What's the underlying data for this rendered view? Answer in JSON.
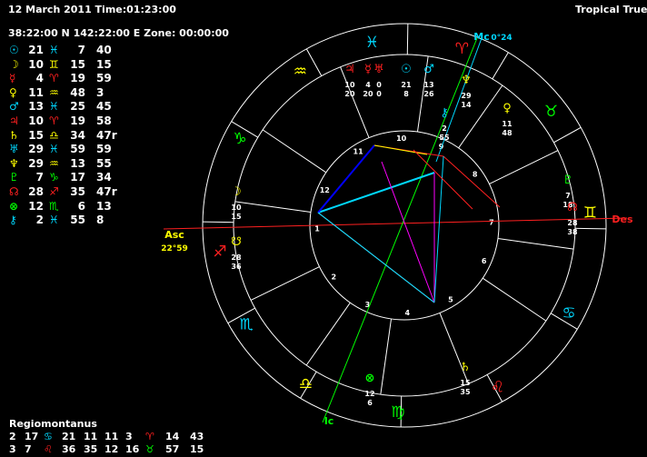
{
  "header": {
    "date_time": "12 March 2011 Time:01:23:00",
    "zodiac": "Tropical True",
    "location": "38:22:00 N 142:22:00 E Zone: 00:00:00"
  },
  "planets": [
    {
      "name": "sun",
      "glyph": "☉",
      "color": "#00d8ff",
      "deg": "21",
      "sign_glyph": "♓",
      "sign_color": "#00d8ff",
      "min": "7",
      "sec": "40"
    },
    {
      "name": "moon",
      "glyph": "☽",
      "color": "#ffff00",
      "deg": "10",
      "sign_glyph": "♊",
      "sign_color": "#ffff00",
      "min": "15",
      "sec": "15"
    },
    {
      "name": "mercury",
      "glyph": "☿",
      "color": "#ff2020",
      "deg": "4",
      "sign_glyph": "♈",
      "sign_color": "#ff2020",
      "min": "19",
      "sec": "59"
    },
    {
      "name": "venus",
      "glyph": "♀",
      "color": "#ffff00",
      "deg": "11",
      "sign_glyph": "♒",
      "sign_color": "#ffff00",
      "min": "48",
      "sec": "3"
    },
    {
      "name": "mars",
      "glyph": "♂",
      "color": "#00d8ff",
      "deg": "13",
      "sign_glyph": "♓",
      "sign_color": "#00d8ff",
      "min": "25",
      "sec": "45"
    },
    {
      "name": "jupiter",
      "glyph": "♃",
      "color": "#ff2020",
      "deg": "10",
      "sign_glyph": "♈",
      "sign_color": "#ff2020",
      "min": "19",
      "sec": "58"
    },
    {
      "name": "saturn",
      "glyph": "♄",
      "color": "#ffff00",
      "deg": "15",
      "sign_glyph": "♎",
      "sign_color": "#ffff00",
      "min": "34",
      "sec": "47r"
    },
    {
      "name": "uranus",
      "glyph": "♅",
      "color": "#00d8ff",
      "deg": "29",
      "sign_glyph": "♓",
      "sign_color": "#00d8ff",
      "min": "59",
      "sec": "59"
    },
    {
      "name": "neptune",
      "glyph": "♆",
      "color": "#ffff00",
      "deg": "29",
      "sign_glyph": "♒",
      "sign_color": "#ffff00",
      "min": "13",
      "sec": "55"
    },
    {
      "name": "pluto",
      "glyph": "♇",
      "color": "#00ff00",
      "deg": "7",
      "sign_glyph": "♑",
      "sign_color": "#00ff00",
      "min": "17",
      "sec": "34"
    },
    {
      "name": "north-node",
      "glyph": "☊",
      "color": "#ff2020",
      "deg": "28",
      "sign_glyph": "♐",
      "sign_color": "#ff2020",
      "min": "35",
      "sec": "47r"
    },
    {
      "name": "part-of-fortune",
      "glyph": "⊗",
      "color": "#00ff00",
      "deg": "12",
      "sign_glyph": "♏",
      "sign_color": "#00ff00",
      "min": "6",
      "sec": "13"
    },
    {
      "name": "chiron",
      "glyph": "⚷",
      "color": "#00d8ff",
      "deg": "2",
      "sign_glyph": "♓",
      "sign_color": "#00d8ff",
      "min": "55",
      "sec": "8"
    }
  ],
  "house_system": {
    "label": "Regiomontanus",
    "rows": [
      [
        "2",
        "17",
        "♋",
        "21",
        "11",
        "11",
        "3",
        "♈",
        "14",
        "43"
      ],
      [
        "3",
        "7",
        "♌",
        "36",
        "35",
        "12",
        "16",
        "♉",
        "57",
        "15"
      ]
    ],
    "row_colors": [
      [
        "#fff",
        "#fff",
        "#00d8ff",
        "#fff",
        "#fff",
        "#fff",
        "#fff",
        "#ff2020",
        "#fff",
        "#fff"
      ],
      [
        "#fff",
        "#fff",
        "#ff2020",
        "#fff",
        "#fff",
        "#fff",
        "#fff",
        "#00ff00",
        "#fff",
        "#fff"
      ]
    ]
  },
  "wheel_signs": [
    {
      "glyph": "♓",
      "color": "#00d8ff"
    },
    {
      "glyph": "♈",
      "color": "#ff2020"
    },
    {
      "glyph": "♉",
      "color": "#00ff00"
    },
    {
      "glyph": "♊",
      "color": "#ffff00"
    },
    {
      "glyph": "♋",
      "color": "#00d8ff"
    },
    {
      "glyph": "♌",
      "color": "#ff2020"
    },
    {
      "glyph": "♍",
      "color": "#00ff00"
    },
    {
      "glyph": "♎",
      "color": "#ffff00"
    },
    {
      "glyph": "♏",
      "color": "#00d8ff"
    },
    {
      "glyph": "♐",
      "color": "#ff2020"
    },
    {
      "glyph": "♑",
      "color": "#00ff00"
    },
    {
      "glyph": "♒",
      "color": "#ffff00"
    }
  ],
  "angles": {
    "asc_label": "Asc",
    "asc_deg": "22",
    "asc_min": "59",
    "des_label": "Des",
    "mc_label": "Mc",
    "mc_deg": "0",
    "mc_min": "24",
    "ic_label": "Ic"
  },
  "house_numbers": [
    "1",
    "2",
    "3",
    "4",
    "5",
    "6",
    "7",
    "8",
    "9",
    "10",
    "11",
    "12"
  ],
  "wheel_planets": [
    {
      "glyph": "♃",
      "color": "#ff2020",
      "deg": "10",
      "min": "20"
    },
    {
      "glyph": "☿",
      "color": "#ff2020",
      "deg": "4",
      "min": "20"
    },
    {
      "glyph": "♅",
      "color": "#ff2020",
      "deg": "0",
      "min": "0"
    },
    {
      "glyph": "☉",
      "color": "#00d8ff",
      "deg": "21",
      "min": "8"
    },
    {
      "glyph": "♂",
      "color": "#00d8ff",
      "deg": "13",
      "min": "26"
    },
    {
      "glyph": "⚷",
      "color": "#00d8ff",
      "deg": "2",
      "min": "55"
    },
    {
      "glyph": "♆",
      "color": "#ffff00",
      "deg": "29",
      "min": "14"
    },
    {
      "glyph": "♀",
      "color": "#ffff00",
      "deg": "11",
      "min": "48"
    },
    {
      "glyph": "♇",
      "color": "#00ff00",
      "deg": "7",
      "min": "18"
    },
    {
      "glyph": "☊",
      "color": "#ff2020",
      "deg": "28",
      "min": "38"
    },
    {
      "glyph": "♄",
      "color": "#ffff00",
      "deg": "15",
      "min": "35"
    },
    {
      "glyph": "⊗",
      "color": "#00ff00",
      "deg": "12",
      "min": "6"
    },
    {
      "glyph": "☋",
      "color": "#ffff00",
      "deg": "28",
      "min": "36"
    },
    {
      "glyph": "☽",
      "color": "#ffff00",
      "deg": "10",
      "min": "15"
    }
  ]
}
